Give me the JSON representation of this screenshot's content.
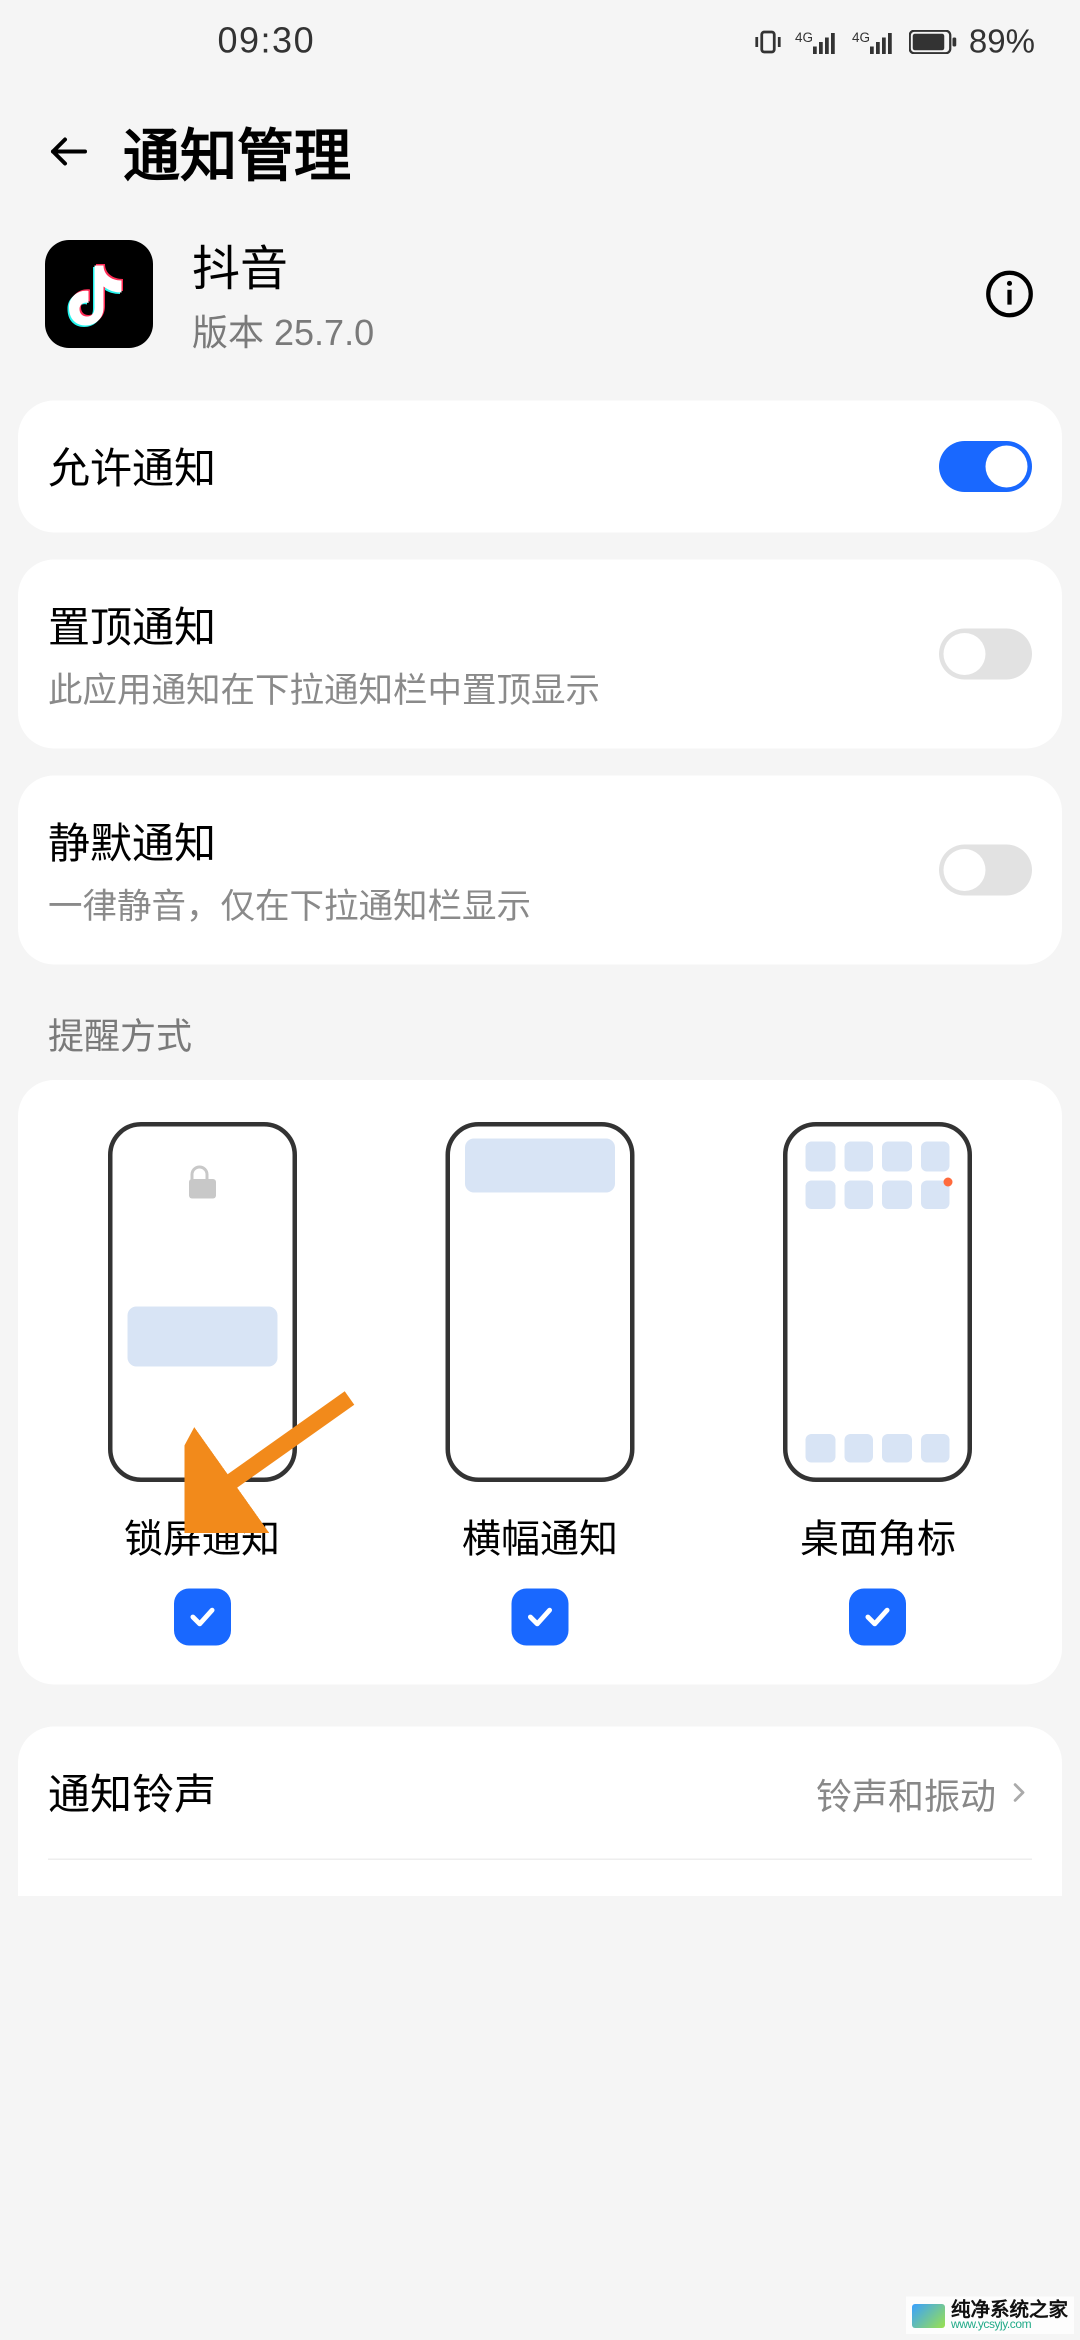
{
  "status": {
    "time": "09:30",
    "battery": "89%"
  },
  "header": {
    "title": "通知管理"
  },
  "app": {
    "name": "抖音",
    "version": "版本 25.7.0"
  },
  "settings": {
    "allow": {
      "label": "允许通知",
      "on": true
    },
    "pin": {
      "label": "置顶通知",
      "desc": "此应用通知在下拉通知栏中置顶显示",
      "on": false
    },
    "quiet": {
      "label": "静默通知",
      "desc": "一律静音，仅在下拉通知栏显示",
      "on": false
    }
  },
  "modes_section": {
    "label": "提醒方式"
  },
  "modes": [
    {
      "label": "锁屏通知",
      "checked": true
    },
    {
      "label": "横幅通知",
      "checked": true
    },
    {
      "label": "桌面角标",
      "checked": true
    }
  ],
  "ringtone": {
    "label": "通知铃声",
    "value": "铃声和振动"
  },
  "watermark": {
    "cn": "纯净系统之家",
    "en": "www.ycsyjy.com"
  },
  "colors": {
    "accent": "#1968ff",
    "arrow": "#f28a1b"
  }
}
